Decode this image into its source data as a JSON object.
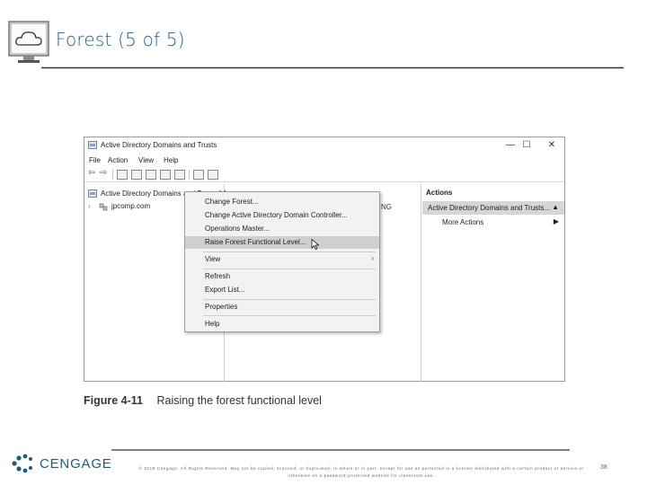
{
  "slide": {
    "title": "Forest (5 of 5)",
    "figure_label": "Figure 4-11",
    "figure_caption": "Raising the forest functional level",
    "footer_copyright": "© 2018 Cengage. All Rights Reserved. May not be copied, scanned, or duplicated, in whole or in part, except for use as permitted in a license distributed with a certain product or service or otherwise on a password-protected website for classroom use.",
    "page_number": "38",
    "logo_text": "CENGAGE",
    "colors": {
      "title": "#2a5b80",
      "logo": "#1c5b80",
      "highlight": "#cfcfcf"
    }
  },
  "window": {
    "title": "Active Directory Domains and Trusts",
    "controls": {
      "minimize": "—",
      "maximize": "☐",
      "close": "✕"
    },
    "menu": [
      "File",
      "Action",
      "View",
      "Help"
    ],
    "tree": {
      "root": "Active Directory Domains and Trusts [ A",
      "child": "jpcomp.com"
    },
    "middle_text": "NG",
    "actions": {
      "header": "Actions",
      "selected": "Active Directory Domains and Trusts...",
      "more": "More Actions"
    },
    "context_menu": {
      "items": [
        {
          "label": "Change Forest..."
        },
        {
          "label": "Change Active Directory Domain Controller..."
        },
        {
          "label": "Operations Master..."
        },
        {
          "label": "Raise Forest Functional Level...",
          "highlighted": true
        },
        {
          "label": "View",
          "submenu": "›"
        },
        {
          "label": "Refresh"
        },
        {
          "label": "Export List..."
        },
        {
          "label": "Properties"
        },
        {
          "label": "Help"
        }
      ]
    }
  }
}
